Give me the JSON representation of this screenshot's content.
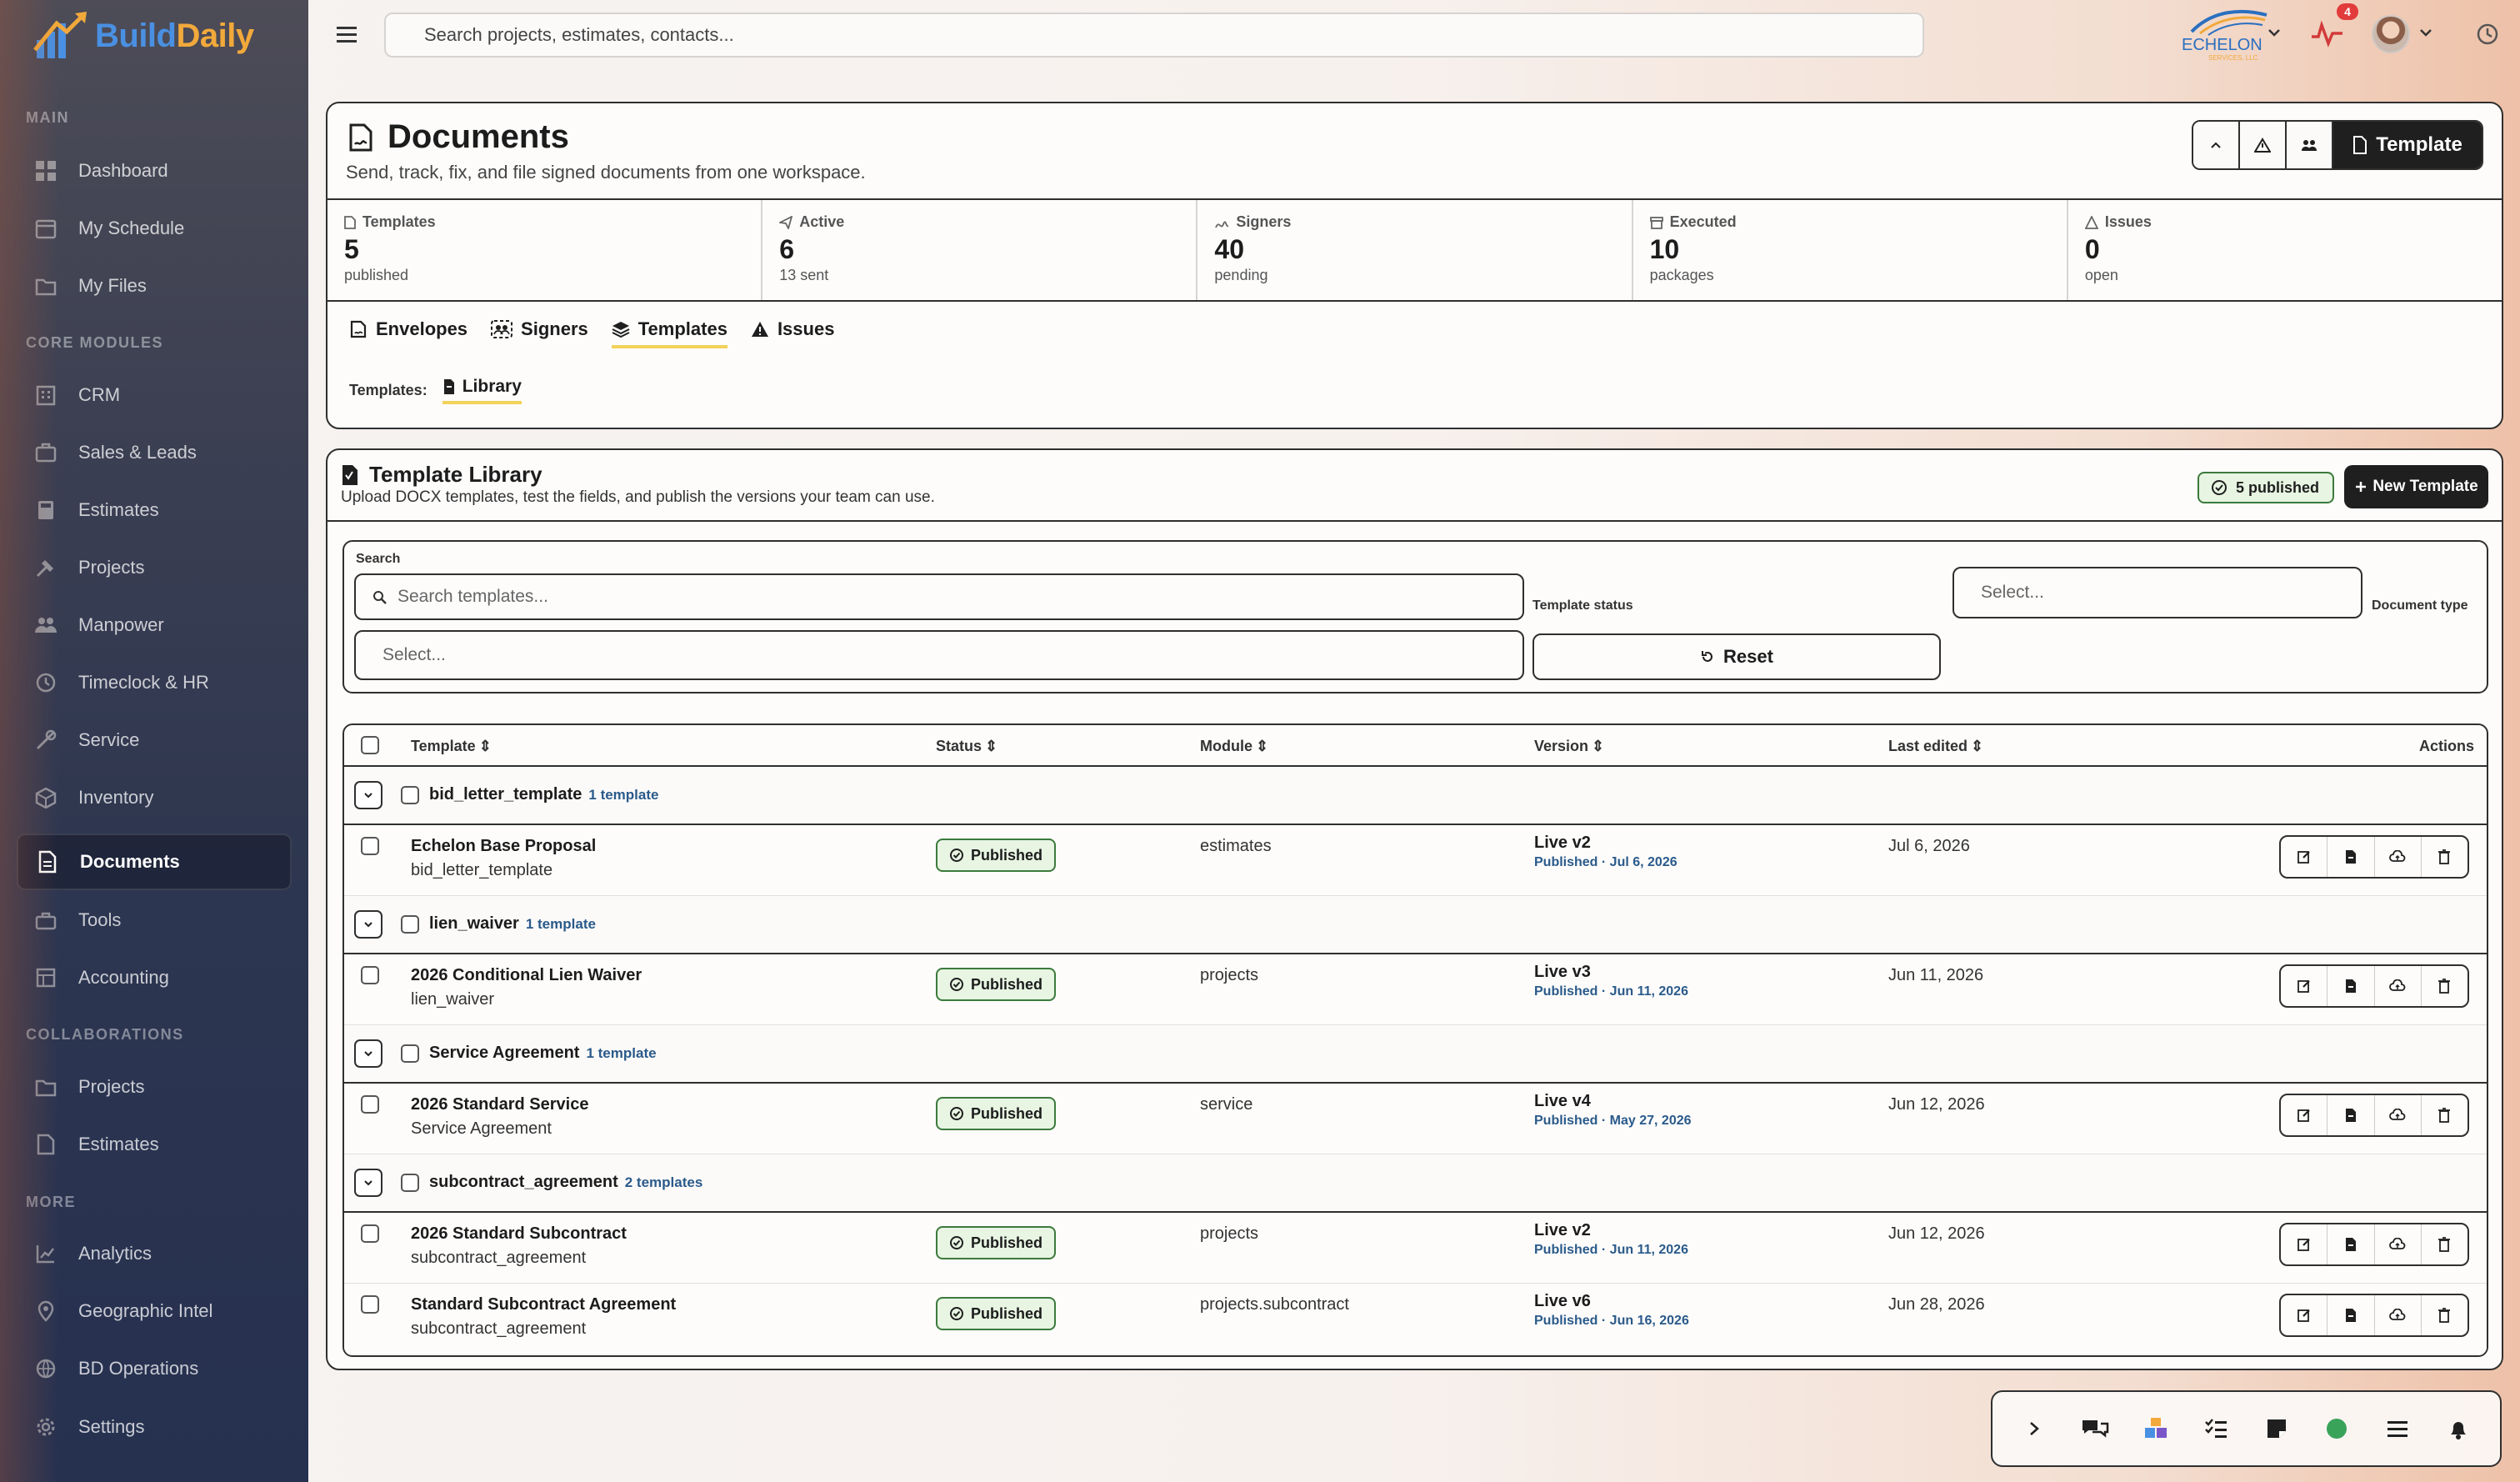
{
  "app": {
    "name_part1": "Build",
    "name_part2": "Daily",
    "company_logo_text": "ECHELON",
    "company_logo_sub": "SERVICES, LLC",
    "notification_count": "4",
    "colors": {
      "brand_blue": "#4a90e2",
      "brand_orange": "#f2a93b",
      "published_green": "#3c7a3c",
      "tab_underline": "#f2d25a"
    }
  },
  "topbar": {
    "search_placeholder": "Search projects, estimates, contacts..."
  },
  "sidebar": {
    "sections": [
      {
        "label": "MAIN",
        "items": [
          {
            "label": "Dashboard",
            "icon": "grid-icon"
          },
          {
            "label": "My Schedule",
            "icon": "calendar-icon"
          },
          {
            "label": "My Files",
            "icon": "folder-icon"
          }
        ]
      },
      {
        "label": "CORE MODULES",
        "items": [
          {
            "label": "CRM",
            "icon": "building-icon"
          },
          {
            "label": "Sales & Leads",
            "icon": "briefcase-icon"
          },
          {
            "label": "Estimates",
            "icon": "calculator-icon"
          },
          {
            "label": "Projects",
            "icon": "hammer-icon"
          },
          {
            "label": "Manpower",
            "icon": "users-icon"
          },
          {
            "label": "Timeclock & HR",
            "icon": "clock-icon"
          },
          {
            "label": "Service",
            "icon": "wrench-icon"
          },
          {
            "label": "Inventory",
            "icon": "box-icon"
          },
          {
            "label": "Documents",
            "icon": "document-icon",
            "active": true
          },
          {
            "label": "Tools",
            "icon": "toolbox-icon"
          },
          {
            "label": "Accounting",
            "icon": "ledger-icon"
          }
        ]
      },
      {
        "label": "COLLABORATIONS",
        "items": [
          {
            "label": "Projects",
            "icon": "folder-icon"
          },
          {
            "label": "Estimates",
            "icon": "document-icon"
          }
        ]
      },
      {
        "label": "MORE",
        "items": [
          {
            "label": "Analytics",
            "icon": "chart-icon"
          },
          {
            "label": "Geographic Intel",
            "icon": "map-pin-icon"
          },
          {
            "label": "BD Operations",
            "icon": "globe-icon"
          },
          {
            "label": "Settings",
            "icon": "gear-icon"
          }
        ]
      }
    ]
  },
  "documents": {
    "title": "Documents",
    "subtitle": "Send, track, fix, and file signed documents from one workspace.",
    "template_button": "Template",
    "stats": [
      {
        "label": "Templates",
        "value": "5",
        "sub": "published",
        "icon": "template-icon"
      },
      {
        "label": "Active",
        "value": "6",
        "sub": "13 sent",
        "icon": "send-icon"
      },
      {
        "label": "Signers",
        "value": "40",
        "sub": "pending",
        "icon": "signers-icon"
      },
      {
        "label": "Executed",
        "value": "10",
        "sub": "packages",
        "icon": "archive-icon"
      },
      {
        "label": "Issues",
        "value": "0",
        "sub": "open",
        "icon": "warning-icon"
      }
    ],
    "tabs": [
      {
        "label": "Envelopes",
        "icon": "envelope-icon"
      },
      {
        "label": "Signers",
        "icon": "signers-icon"
      },
      {
        "label": "Templates",
        "icon": "layers-icon",
        "active": true
      },
      {
        "label": "Issues",
        "icon": "warning-icon"
      }
    ],
    "subtabs_label": "Templates:",
    "subtab_active": "Library"
  },
  "library": {
    "title": "Template Library",
    "subtitle": "Upload DOCX templates, test the fields, and publish the versions your team can use.",
    "published_badge": "5 published",
    "new_button": "New Template",
    "filters": {
      "search_label": "Search",
      "search_placeholder": "Search templates...",
      "status_label": "Template status",
      "status_placeholder": "Select...",
      "type_label": "Document type",
      "type_placeholder": "Select...",
      "reset_label": "Reset"
    },
    "columns": [
      "Template",
      "Status",
      "Module",
      "Version",
      "Last edited",
      "Actions"
    ],
    "groups": [
      {
        "name": "bid_letter_template",
        "count": "1 template",
        "rows": [
          {
            "name": "Echelon Base Proposal",
            "key": "bid_letter_template",
            "status": "Published",
            "module": "estimates",
            "version": "Live v2",
            "published": "Published · Jul 6, 2026",
            "edited": "Jul 6, 2026"
          }
        ]
      },
      {
        "name": "lien_waiver",
        "count": "1 template",
        "rows": [
          {
            "name": "2026 Conditional Lien Waiver",
            "key": "lien_waiver",
            "status": "Published",
            "module": "projects",
            "version": "Live v3",
            "published": "Published · Jun 11, 2026",
            "edited": "Jun 11, 2026"
          }
        ]
      },
      {
        "name": "Service Agreement",
        "count": "1 template",
        "rows": [
          {
            "name": "2026 Standard Service",
            "key": "Service Agreement",
            "status": "Published",
            "module": "service",
            "version": "Live v4",
            "published": "Published · May 27, 2026",
            "edited": "Jun 12, 2026"
          }
        ]
      },
      {
        "name": "subcontract_agreement",
        "count": "2 templates",
        "rows": [
          {
            "name": "2026 Standard Subcontract",
            "key": "subcontract_agreement",
            "status": "Published",
            "module": "projects",
            "version": "Live v2",
            "published": "Published · Jun 11, 2026",
            "edited": "Jun 12, 2026"
          },
          {
            "name": "Standard Subcontract Agreement",
            "key": "subcontract_agreement",
            "status": "Published",
            "module": "projects.subcontract",
            "version": "Live v6",
            "published": "Published · Jun 16, 2026",
            "edited": "Jun 28, 2026"
          }
        ]
      }
    ]
  }
}
